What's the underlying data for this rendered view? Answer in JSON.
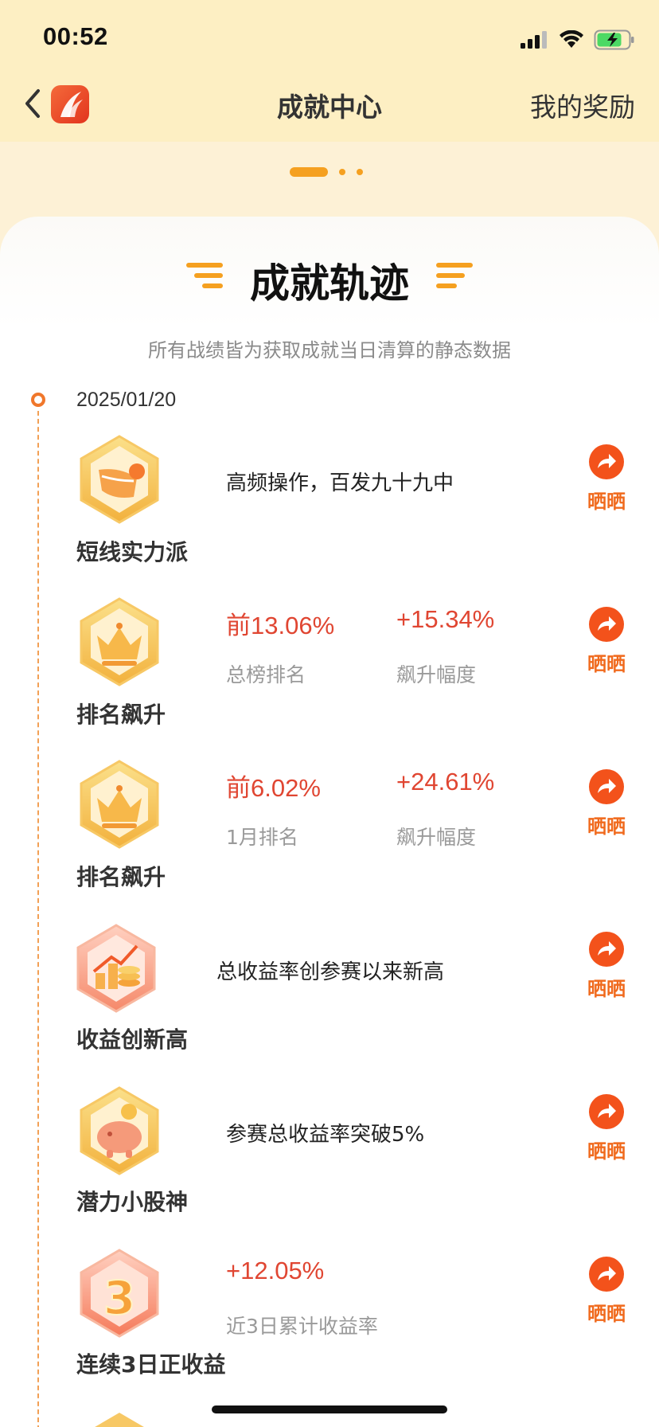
{
  "status_bar": {
    "time": "00:52"
  },
  "nav": {
    "title": "成就中心",
    "right_label": "我的奖励"
  },
  "pager": {
    "count": 3,
    "active_index": 0
  },
  "section": {
    "title": "成就轨迹",
    "subtitle": "所有战绩皆为获取成就当日清算的静态数据"
  },
  "timeline": {
    "date": "2025/01/20"
  },
  "share_label": "晒晒",
  "achievements": [
    {
      "name": "短线实力派",
      "description": "高频操作，百发九十九中",
      "badge_icon": "fast-trade-badge-icon"
    },
    {
      "name": "排名飙升",
      "stat1_value": "前13.06%",
      "stat1_label": "总榜排名",
      "stat2_value": "+15.34%",
      "stat2_label": "飙升幅度",
      "badge_icon": "crown-badge-icon"
    },
    {
      "name": "排名飙升",
      "stat1_value": "前6.02%",
      "stat1_label": "1月排名",
      "stat2_value": "+24.61%",
      "stat2_label": "飙升幅度",
      "badge_icon": "crown-badge-icon"
    },
    {
      "name": "收益创新高",
      "description": "总收益率创参赛以来新高",
      "badge_icon": "rising-coins-badge-icon"
    },
    {
      "name": "潜力小股神",
      "description": "参赛总收益率突破5%",
      "badge_icon": "piggy-bank-badge-icon"
    },
    {
      "name": "连续3日正收益",
      "stat1_value": "+12.05%",
      "stat1_label": "近3日累计收益率",
      "badge_icon": "number-3-badge-icon"
    }
  ],
  "colors": {
    "accent": "#f06a1d",
    "stat_red": "#e04632",
    "nav_bg": "#fdefc3"
  }
}
